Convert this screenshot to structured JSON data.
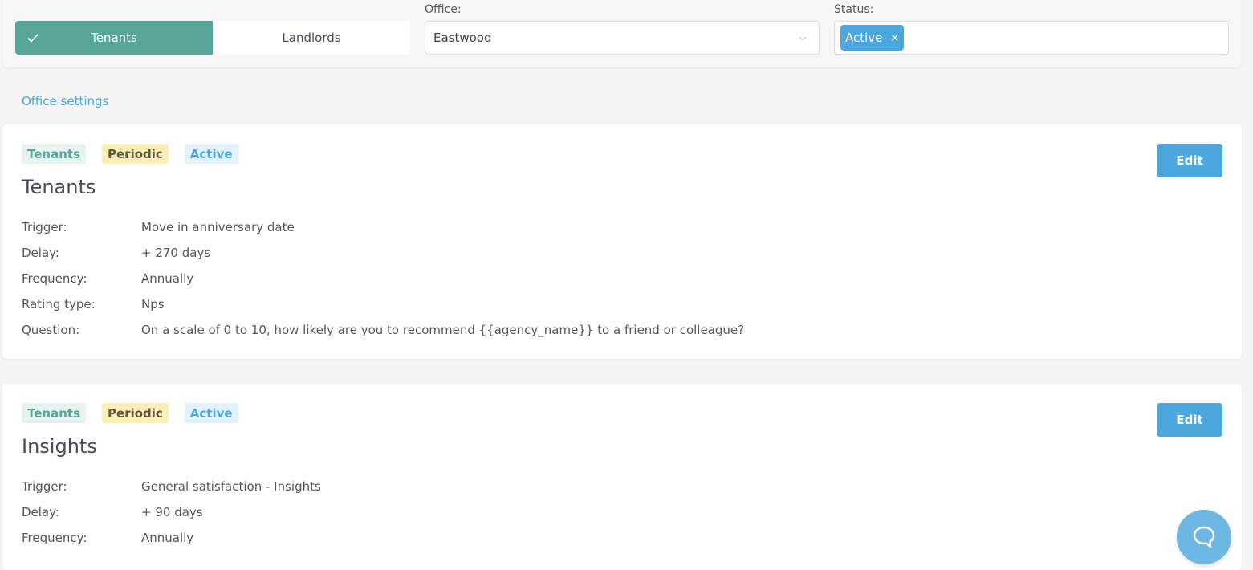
{
  "filters": {
    "toggle": {
      "tenants_label": "Tenants",
      "landlords_label": "Landlords",
      "selected": "Tenants"
    },
    "office": {
      "label": "Office:",
      "value": "Eastwood"
    },
    "status": {
      "label": "Status:",
      "chips": [
        "Active"
      ],
      "remove_glyph": "×"
    }
  },
  "office_settings_link": "Office settings",
  "cards": [
    {
      "badges": [
        "Tenants",
        "Periodic",
        "Active"
      ],
      "title": "Tenants",
      "edit_label": "Edit",
      "rows": [
        {
          "key": "Trigger:",
          "value": "Move in anniversary date"
        },
        {
          "key": "Delay:",
          "value": "+ 270 days"
        },
        {
          "key": "Frequency:",
          "value": "Annually"
        },
        {
          "key": "Rating type:",
          "value": "Nps"
        },
        {
          "key": "Question:",
          "value": "On a scale of 0 to 10, how likely are you to recommend {{agency_name}} to a friend or colleague?"
        }
      ]
    },
    {
      "badges": [
        "Tenants",
        "Periodic",
        "Active"
      ],
      "title": "Insights",
      "edit_label": "Edit",
      "rows": [
        {
          "key": "Trigger:",
          "value": "General satisfaction - Insights"
        },
        {
          "key": "Delay:",
          "value": "+ 90 days"
        },
        {
          "key": "Frequency:",
          "value": "Annually"
        }
      ]
    }
  ],
  "colors": {
    "teal": "#58a69a",
    "blue": "#4ba7dd",
    "yellow": "#fdefb3"
  },
  "icons": {
    "check": "check-icon",
    "chevron": "chevron-down-icon",
    "chat": "chat-bubble-icon"
  }
}
